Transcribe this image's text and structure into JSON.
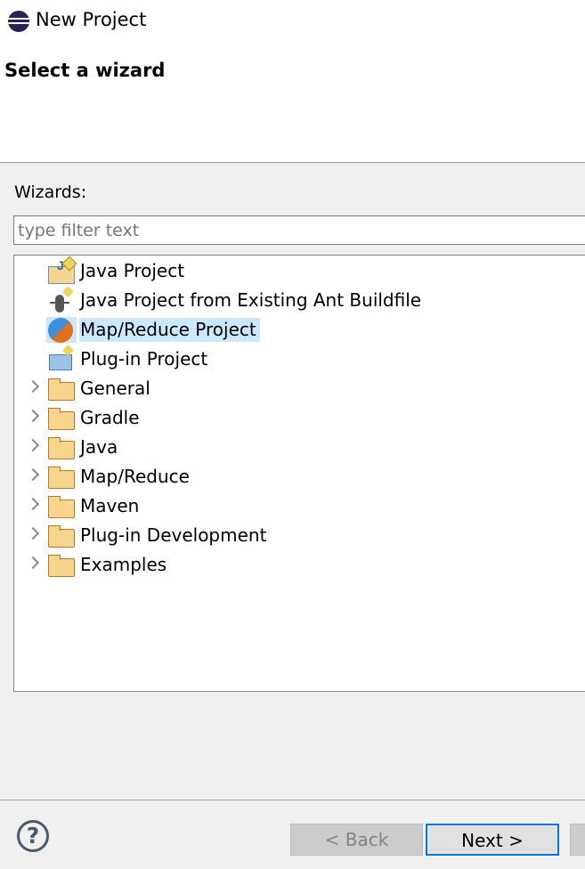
{
  "window": {
    "title": "New Project"
  },
  "page": {
    "subtitle": "Select a wizard"
  },
  "wizards": {
    "label": "Wizards:",
    "filter_placeholder": "type filter text",
    "filter_value": ""
  },
  "tree": [
    {
      "label": "Java Project",
      "icon": "java-project-icon",
      "expandable": false,
      "selected": false
    },
    {
      "label": "Java Project from Existing Ant Buildfile",
      "icon": "ant-icon",
      "expandable": false,
      "selected": false
    },
    {
      "label": "Map/Reduce Project",
      "icon": "mapreduce-icon",
      "expandable": false,
      "selected": true
    },
    {
      "label": "Plug-in Project",
      "icon": "plugin-project-icon",
      "expandable": false,
      "selected": false
    },
    {
      "label": "General",
      "icon": "folder-icon",
      "expandable": true
    },
    {
      "label": "Gradle",
      "icon": "folder-icon",
      "expandable": true
    },
    {
      "label": "Java",
      "icon": "folder-icon",
      "expandable": true
    },
    {
      "label": "Map/Reduce",
      "icon": "folder-icon",
      "expandable": true
    },
    {
      "label": "Maven",
      "icon": "folder-icon",
      "expandable": true
    },
    {
      "label": "Plug-in Development",
      "icon": "folder-icon",
      "expandable": true
    },
    {
      "label": "Examples",
      "icon": "folder-icon",
      "expandable": true
    }
  ],
  "buttons": {
    "help": "?",
    "back": "< Back",
    "next": "Next >"
  },
  "colors": {
    "selection": "#cce8ff",
    "default_button_border": "#0078d7"
  }
}
